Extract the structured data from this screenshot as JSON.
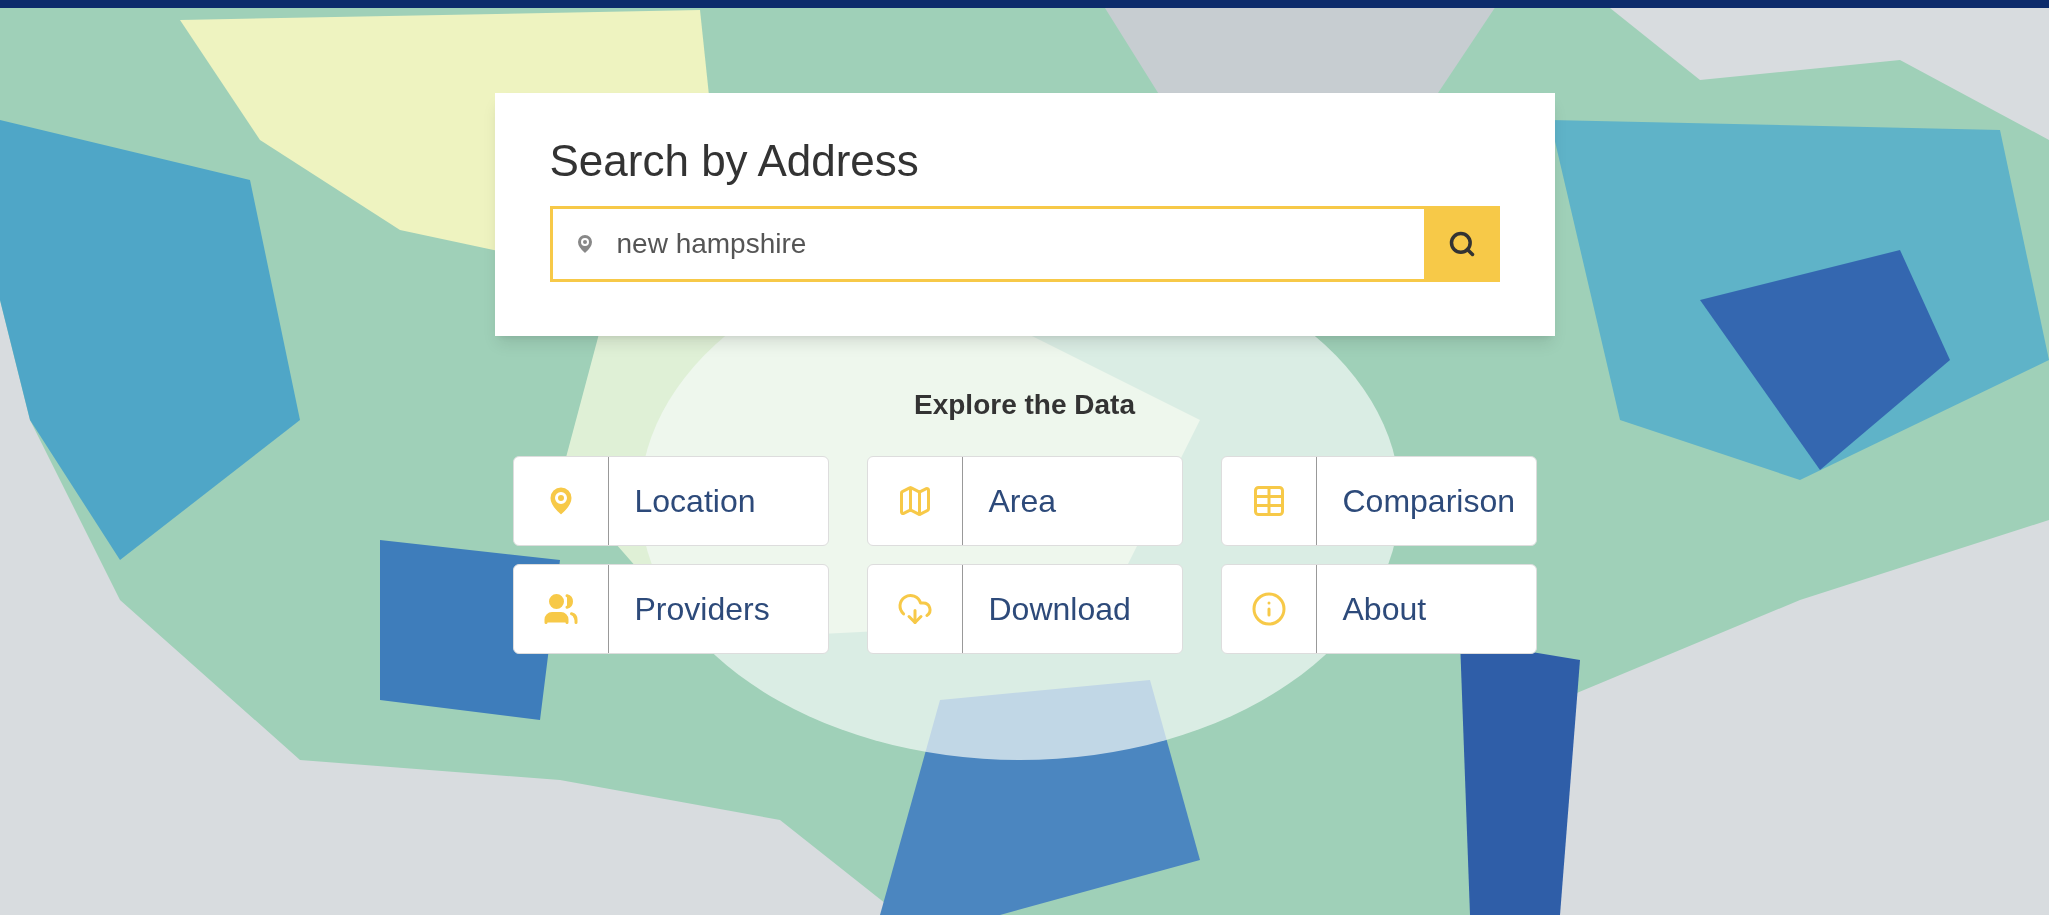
{
  "search": {
    "title": "Search by Address",
    "value": "new hampshire"
  },
  "explore": {
    "title": "Explore the Data",
    "buttons": [
      {
        "label": "Location"
      },
      {
        "label": "Area"
      },
      {
        "label": "Comparison"
      },
      {
        "label": "Providers"
      },
      {
        "label": "Download"
      },
      {
        "label": "About"
      }
    ]
  }
}
